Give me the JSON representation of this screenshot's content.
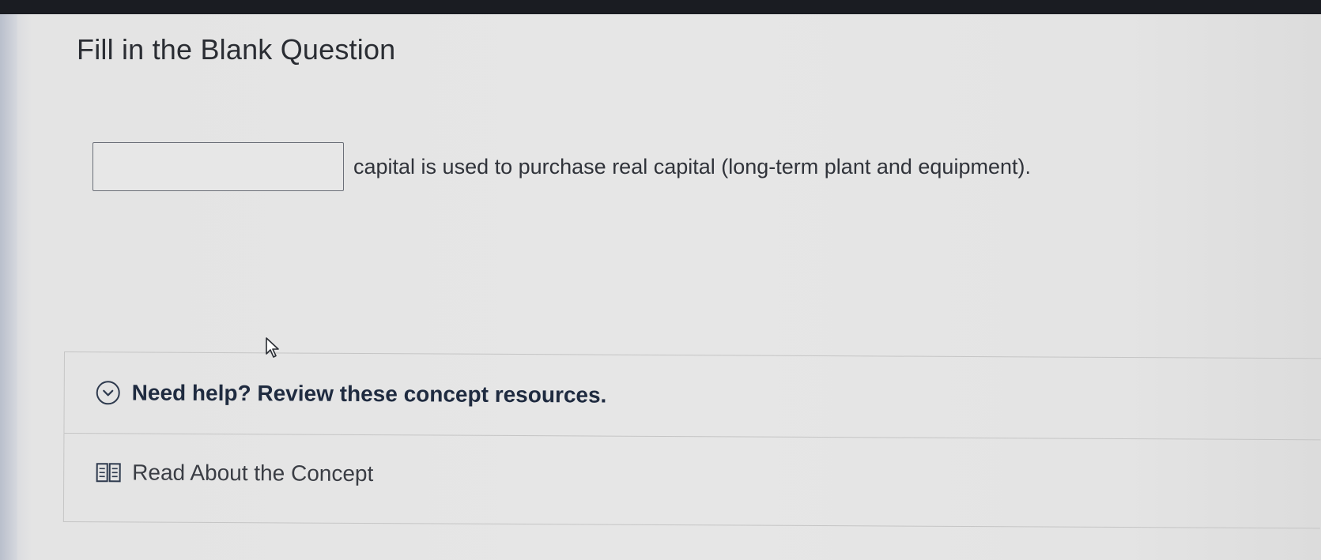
{
  "page": {
    "title": "Fill in the Blank Question"
  },
  "question": {
    "blank_value": "",
    "text": "capital is used to purchase real capital (long-term plant and equipment)."
  },
  "help": {
    "toggle_icon": "chevron-down-circle-icon",
    "label": "Need help? Review these concept resources.",
    "resources": [
      {
        "icon": "book-icon",
        "label": "Read About the Concept"
      }
    ]
  },
  "colors": {
    "heading": "#2a2d33",
    "help_text": "#1f2b40",
    "border": "#c5c5c5",
    "background": "#e6e6e6"
  }
}
